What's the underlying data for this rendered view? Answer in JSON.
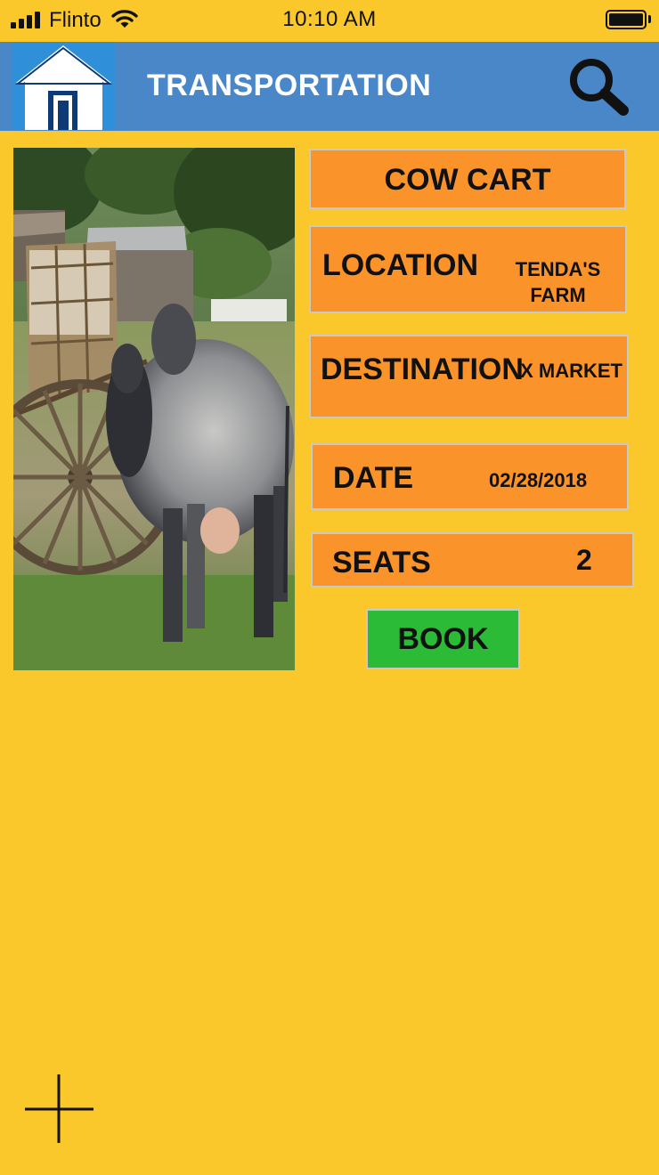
{
  "status_bar": {
    "carrier": "Flinto",
    "time": "10:10 AM",
    "icons": [
      "signal-icon",
      "wifi-icon",
      "battery-icon"
    ]
  },
  "header": {
    "title": "TRANSPORTATION",
    "home_icon": "home-icon",
    "search_icon": "search-icon",
    "background": "#4A87C8"
  },
  "photo": {
    "subject": "cow-cart-photo"
  },
  "details": {
    "title": "COW CART",
    "location_label": "LOCATION",
    "location_value": "TENDA'S FARM",
    "destination_label": "DESTINATION",
    "destination_value": "X MARKET",
    "date_label": "DATE",
    "date_value": "02/28/2018",
    "seats_label": "SEATS",
    "seats_value": "2"
  },
  "actions": {
    "book_label": "BOOK",
    "add_icon": "plus-icon"
  },
  "colors": {
    "page_background": "#FBC82C",
    "card_background": "#FA932A",
    "book_button": "#2CBB36",
    "header_title": "#FFFFFF"
  }
}
